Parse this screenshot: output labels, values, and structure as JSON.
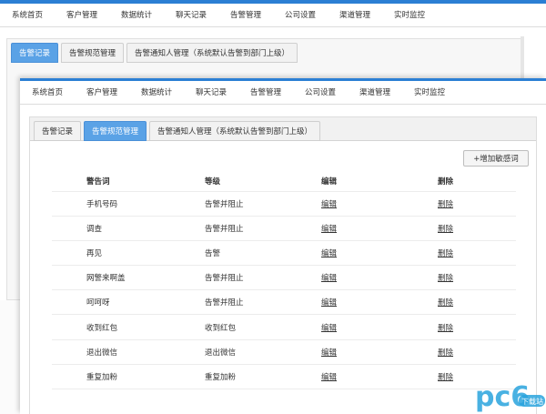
{
  "back": {
    "nav": [
      "系统首页",
      "客户管理",
      "数据统计",
      "聊天记录",
      "告警管理",
      "公司设置",
      "渠道管理",
      "实时监控"
    ],
    "tabs": [
      {
        "label": "告警记录",
        "active": true
      },
      {
        "label": "告警规范管理",
        "active": false
      },
      {
        "label": "告警通知人管理（系统默认告警到部门上级）",
        "active": false
      }
    ]
  },
  "front": {
    "nav": [
      "系统首页",
      "客户管理",
      "数据统计",
      "聊天记录",
      "告警管理",
      "公司设置",
      "渠道管理",
      "实时监控"
    ],
    "tabs": [
      {
        "label": "告警记录",
        "active": false
      },
      {
        "label": "告警规范管理",
        "active": true
      },
      {
        "label": "告警通知人管理（系统默认告警到部门上级）",
        "active": false
      }
    ],
    "add_button": "+增加敏感词",
    "table": {
      "headers": [
        "警告词",
        "等级",
        "编辑",
        "删除"
      ],
      "rows": [
        {
          "word": "手机号码",
          "level": "告警并阻止",
          "edit": "编辑",
          "delete": "删除"
        },
        {
          "word": "调查",
          "level": "告警并阻止",
          "edit": "编辑",
          "delete": "删除"
        },
        {
          "word": "再见",
          "level": "告警",
          "edit": "编辑",
          "delete": "删除"
        },
        {
          "word": "网警来啊盖",
          "level": "告警并阻止",
          "edit": "编辑",
          "delete": "删除"
        },
        {
          "word": "呵呵呀",
          "level": "告警并阻止",
          "edit": "编辑",
          "delete": "删除"
        },
        {
          "word": "收到红包",
          "level": "收到红包",
          "edit": "编辑",
          "delete": "删除"
        },
        {
          "word": "退出微信",
          "level": "退出微信",
          "edit": "编辑",
          "delete": "删除"
        },
        {
          "word": "重复加粉",
          "level": "重复加粉",
          "edit": "编辑",
          "delete": "删除"
        }
      ]
    }
  },
  "colors": {
    "accent": "#2b7fd4",
    "active_tab": "#5aa2e6",
    "watermark": "#29a3dd"
  },
  "watermark": {
    "logo": "pc6",
    "badge": "下载站"
  }
}
